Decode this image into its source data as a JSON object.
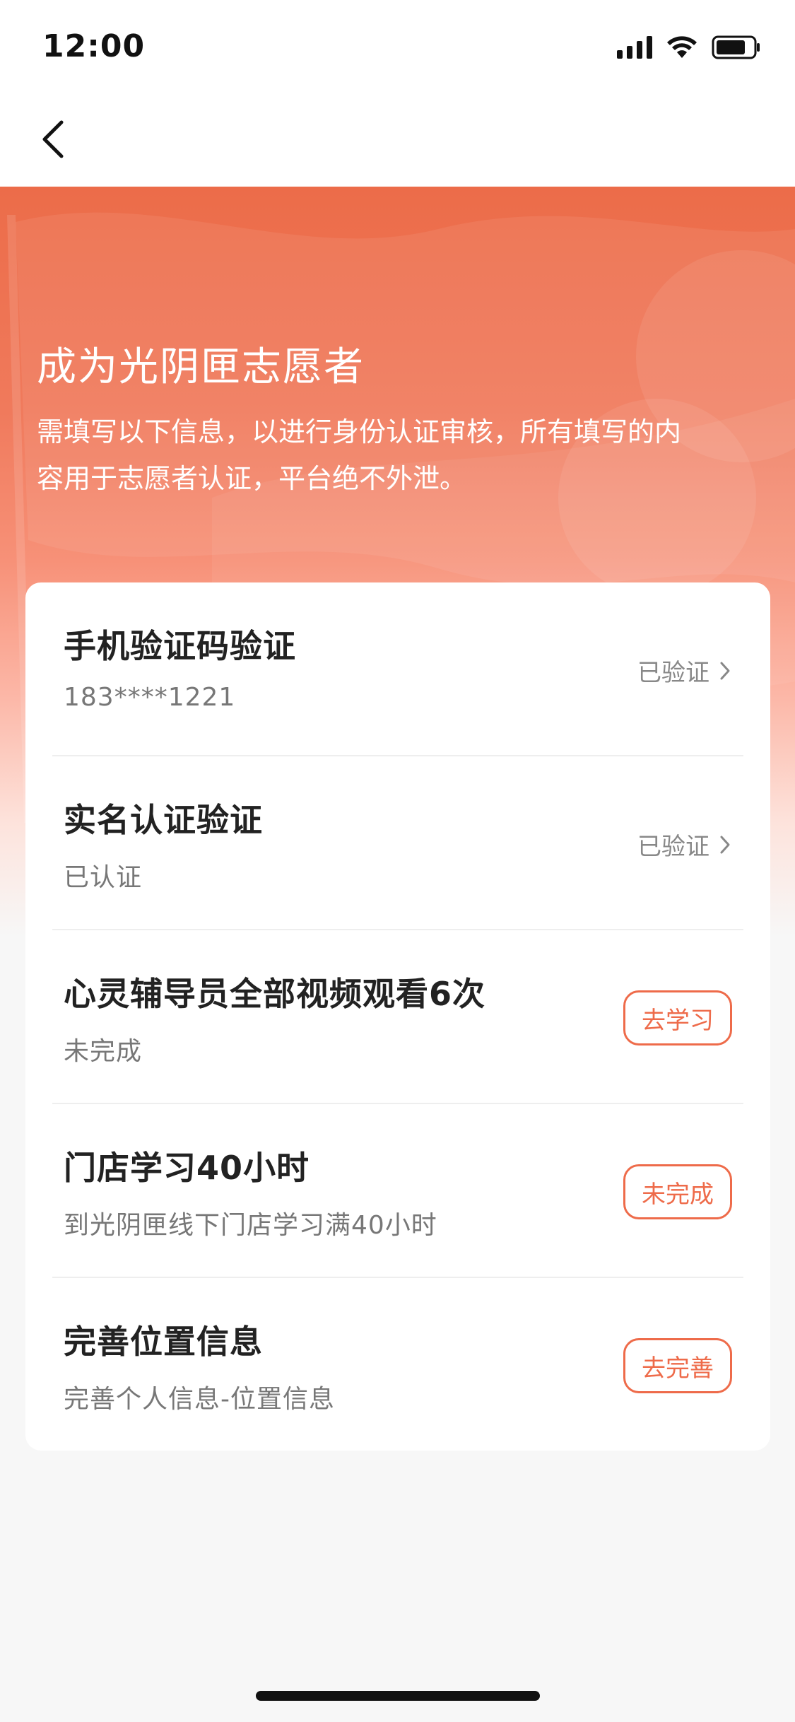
{
  "status_bar": {
    "time": "12:00"
  },
  "nav": {
    "back_icon": "chevron-left-icon"
  },
  "hero": {
    "title": "成为光阴匣志愿者",
    "description": "需填写以下信息，以进行身份认证审核，所有填写的内容用于志愿者认证，平台绝不外泄。"
  },
  "items": [
    {
      "title": "手机验证码验证",
      "subtitle": "183****1221",
      "status": "已验证"
    },
    {
      "title": "实名认证验证",
      "subtitle": "已认证",
      "status": "已验证"
    },
    {
      "title": "心灵辅导员全部视频观看6次",
      "subtitle": "未完成",
      "button": "去学习"
    },
    {
      "title": "门店学习40小时",
      "subtitle": "到光阴匣线下门店学习满40小时",
      "button": "未完成"
    },
    {
      "title": "完善位置信息",
      "subtitle": "完善个人信息-位置信息",
      "button": "去完善"
    }
  ],
  "colors": {
    "accent": "#ee6b4a",
    "hero_top": "#ec6c49",
    "background": "#f7f7f7"
  }
}
